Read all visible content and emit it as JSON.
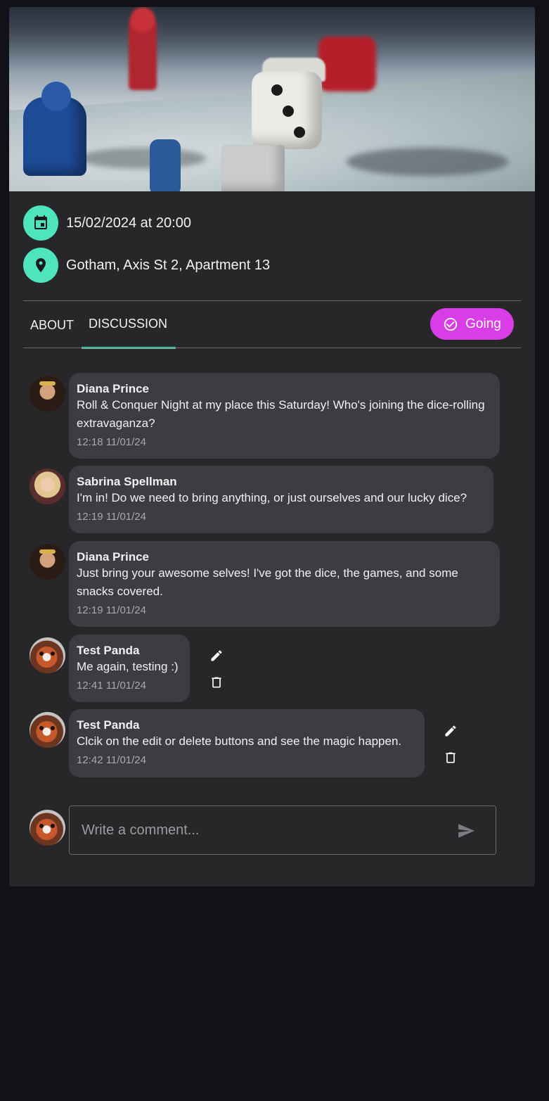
{
  "event": {
    "date_time": "15/02/2024 at 20:00",
    "location": "Gotham, Axis St 2, Apartment 13",
    "calendar_icon": "calendar-icon",
    "location_icon": "map-pin-icon"
  },
  "tabs": [
    {
      "label": "ABOUT",
      "active": false
    },
    {
      "label": "DISCUSSION",
      "active": true
    }
  ],
  "going_button": {
    "label": "Going",
    "icon": "check-circle-icon"
  },
  "comments": [
    {
      "author": "Diana Prince",
      "text": "Roll & Conquer Night at my place this Saturday! Who's joining the dice-rolling extravaganza?",
      "time": "12:18 11/01/24",
      "own": false
    },
    {
      "author": "Sabrina Spellman",
      "text": "I'm in! Do we need to bring anything, or just ourselves and our lucky dice?",
      "time": "12:19 11/01/24",
      "own": false
    },
    {
      "author": "Diana Prince",
      "text": "Just bring your awesome selves! I've got the dice, the games, and some snacks covered.",
      "time": "12:19 11/01/24",
      "own": false
    },
    {
      "author": "Test Panda",
      "text": "Me again, testing :)",
      "time": "12:41 11/01/24",
      "own": true
    },
    {
      "author": "Test Panda",
      "text": "Clcik on the edit or delete buttons and see the magic happen.",
      "time": "12:42 11/01/24",
      "own": true
    }
  ],
  "comment_input": {
    "placeholder": "Write a comment...",
    "value": ""
  },
  "colors": {
    "accent": "#4ee5bd",
    "going": "#d93de6",
    "card": "#272629",
    "bubble": "#3d3c41",
    "page": "#121117"
  }
}
